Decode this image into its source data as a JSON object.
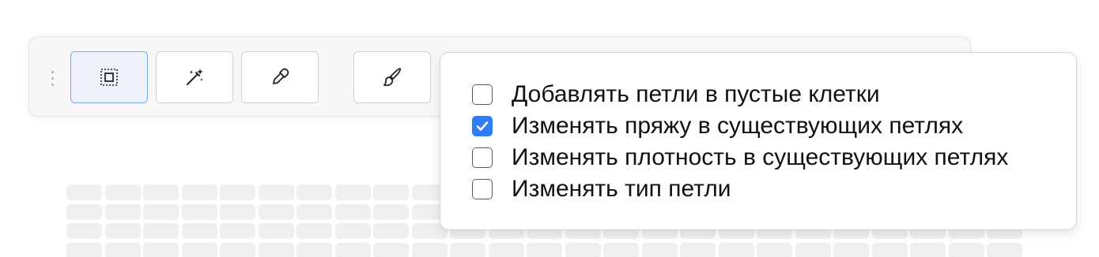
{
  "toolbar": {
    "tools": [
      {
        "icon": "selection-icon",
        "active": true
      },
      {
        "icon": "magic-wand-icon",
        "active": false
      },
      {
        "icon": "eyedropper-icon",
        "active": false
      },
      {
        "icon": "paintbrush-icon",
        "active": false
      }
    ]
  },
  "popover": {
    "options": [
      {
        "label": "Добавлять петли в пустые клетки",
        "checked": false
      },
      {
        "label": "Изменять пряжу в существующих петлях",
        "checked": true
      },
      {
        "label": "Изменять плотность в существующих петлях",
        "checked": false
      },
      {
        "label": "Изменять тип петли",
        "checked": false
      }
    ]
  },
  "colors": {
    "accent": "#2f7df6",
    "active_tool_border": "#7aa6dc",
    "grid_cell": "#efefef"
  }
}
